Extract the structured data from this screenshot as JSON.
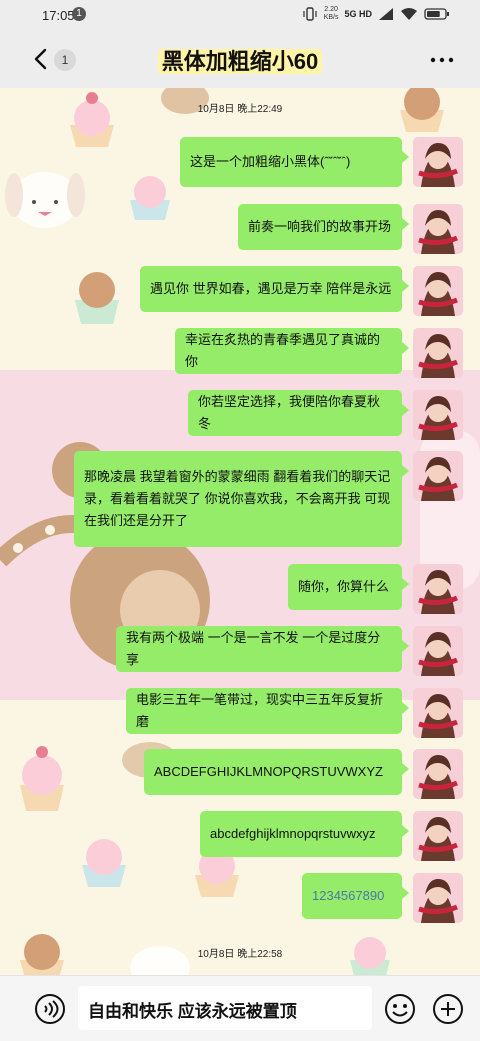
{
  "status_bar": {
    "time": "17:05",
    "notification_count": "1",
    "speed_value": "2.20",
    "speed_unit": "KB/s",
    "network": "5G HD",
    "battery_level": 0.75
  },
  "header": {
    "unread_badge": "1",
    "title": "黑体加粗缩小60"
  },
  "timestamps": [
    "10月8日 晚上22:49",
    "10月8日 晚上22:58"
  ],
  "messages": [
    {
      "text": "这是一个加粗缩小黑体(ˆ˘ˆ˘ˆ) "
    },
    {
      "text": "前奏一响我们的故事开场"
    },
    {
      "text": "遇见你 世界如春，遇见是万幸 陪伴是永远"
    },
    {
      "text": "幸运在炙热的青春季遇见了真诚的你"
    },
    {
      "text": "你若坚定选择，我便陪你春夏秋冬"
    },
    {
      "text": "那晚凌晨 我望着窗外的蒙蒙细雨 翻看着我们的聊天记录，看着看着就哭了 你说你喜欢我，不会离开我 可现在我们还是分开了"
    },
    {
      "text": "随你，你算什么"
    },
    {
      "text": "我有两个极端 一个是一言不发 一个是过度分享"
    },
    {
      "text": "电影三五年一笔带过，现实中三五年反复折磨"
    },
    {
      "text": "ABCDEFGHIJKLMNOPQRSTUVWXYZ"
    },
    {
      "text": "abcdefghijklmnopqrstuvwxyz"
    },
    {
      "text": "1234567890"
    }
  ],
  "input": {
    "text": "自由和快乐 应该永远被置顶"
  },
  "icons": {
    "back": "chevron-left-icon",
    "more": "more-dots-icon",
    "voice": "voice-icon",
    "emoji": "emoji-icon",
    "plus": "plus-icon"
  },
  "colors": {
    "bubble": "#95ec69",
    "header_bg": "#ededed",
    "link": "#4a7aa6"
  }
}
